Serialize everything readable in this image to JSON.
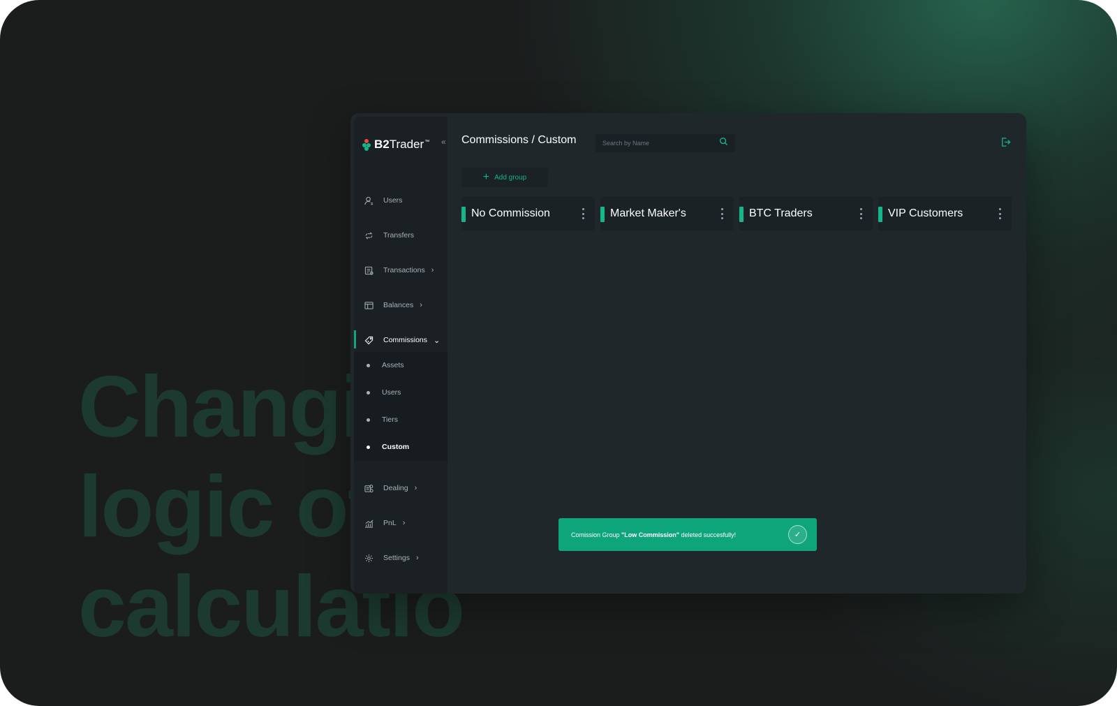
{
  "background": {
    "headline_lines": [
      "Changi",
      "logic of",
      "calculatio"
    ]
  },
  "brand": {
    "name_bold": "B2",
    "name_rest": "Trader",
    "trademark": "™",
    "collapse_icon": "double-chevron-left"
  },
  "sidebar": {
    "items": [
      {
        "label": "Users",
        "icon": "user-icon"
      },
      {
        "label": "Transfers",
        "icon": "transfer-icon"
      },
      {
        "label": "Transactions",
        "icon": "transactions-icon"
      },
      {
        "label": "Balances",
        "icon": "balances-icon"
      },
      {
        "label": "Commissions",
        "icon": "tag-icon"
      },
      {
        "label": "Dealing",
        "icon": "dealing-icon"
      },
      {
        "label": "PnL",
        "icon": "chart-icon"
      },
      {
        "label": "Settings",
        "icon": "gear-icon"
      }
    ],
    "submenu": [
      {
        "label": "Assets"
      },
      {
        "label": "Users"
      },
      {
        "label": "Tiers"
      },
      {
        "label": "Custom"
      }
    ]
  },
  "header": {
    "breadcrumb": "Commissions / Custom",
    "search_placeholder": "Search by Name"
  },
  "actions": {
    "add_group": "Add group"
  },
  "groups": [
    {
      "name": "No Commission"
    },
    {
      "name": "Market Maker's"
    },
    {
      "name": "BTC Traders"
    },
    {
      "name": "VIP Customers"
    }
  ],
  "toast": {
    "prefix": "Comission Group ",
    "highlight": "\"Low Commission\"",
    "suffix": " deleted succesfully!"
  },
  "colors": {
    "accent": "#14b68a",
    "toast_bg": "#0fa57b",
    "app_bg": "#1f272b",
    "sidebar_bg": "#1a2024"
  }
}
